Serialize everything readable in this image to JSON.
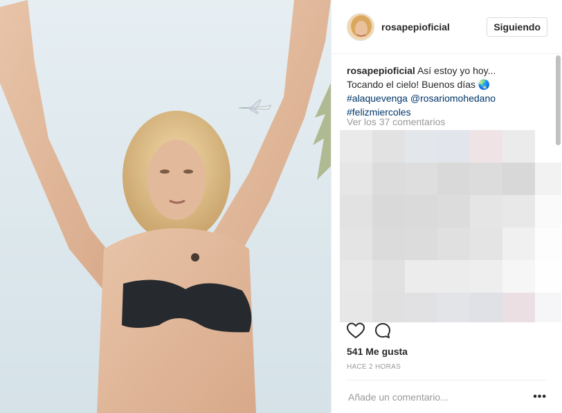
{
  "post": {
    "image_alt": "photo",
    "username": "rosapepioficial",
    "follow_label": "Siguiendo",
    "caption": {
      "username": "rosapepioficial",
      "text": "Así estoy yo hoy... Tocando el cielo! Buenos días",
      "emoji": "🌏",
      "hashtag1": "#alaquevenga",
      "mention": "@rosariomohedano",
      "hashtag2": "#felizmiercoles"
    },
    "view_comments": "Ver los 37 comentarios",
    "likes": "541 Me gusta",
    "time": "HACE 2 HORAS",
    "comment_placeholder": "Añade un comentario...",
    "more_label": "•••"
  },
  "colors": {
    "link": "#003569",
    "muted": "#999999",
    "text": "#262626"
  },
  "icons": [
    "heart-icon",
    "comment-icon",
    "more-options-icon"
  ]
}
